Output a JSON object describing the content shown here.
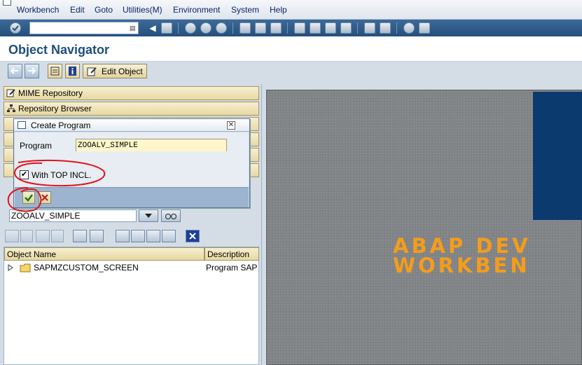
{
  "menubar": {
    "items": [
      {
        "label": "Workbench"
      },
      {
        "label": "Edit"
      },
      {
        "label": "Goto"
      },
      {
        "label": "Utilities(M)"
      },
      {
        "label": "Environment"
      },
      {
        "label": "System"
      },
      {
        "label": "Help"
      }
    ]
  },
  "page": {
    "title": "Object Navigator"
  },
  "apptoolbar": {
    "edit_object_label": "Edit Object"
  },
  "leftpanel": {
    "nav": [
      {
        "label": "MIME Repository"
      },
      {
        "label": "Repository Browser"
      }
    ],
    "object_input_value": "ZOOALV_SIMPLE",
    "tree": {
      "columns": [
        "Object Name",
        "Description"
      ],
      "rows": [
        {
          "name": "SAPMZCUSTOM_SCREEN",
          "description": "Program SAPI"
        }
      ]
    }
  },
  "dialog": {
    "title": "Create Program",
    "program_label": "Program",
    "program_value": "ZOOALV_SIMPLE",
    "top_incl_label": "With TOP INCL.",
    "top_incl_checked": true
  },
  "banner": {
    "line1": "ABAP DEV",
    "line2": "WORKBEN"
  },
  "colors": {
    "banner_orange": "#f59c1c",
    "annotation_red": "#e0141e",
    "title_blue": "#1f4d7a"
  }
}
